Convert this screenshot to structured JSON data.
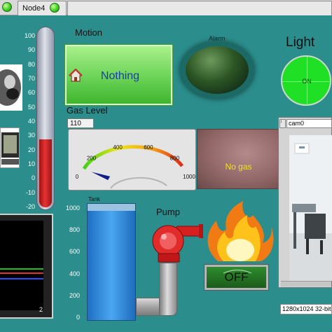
{
  "tabs": [
    {
      "label": "Node4"
    }
  ],
  "thermometer": {
    "ticks": [
      "100",
      "90",
      "80",
      "70",
      "60",
      "50",
      "40",
      "30",
      "20",
      "10",
      "0",
      "-10",
      "-20"
    ],
    "level": 0.38
  },
  "motion": {
    "label": "Motion",
    "button_label": "Nothing",
    "icon": "home-icon"
  },
  "alarm": {
    "label": "Alarm"
  },
  "light": {
    "label": "Light",
    "state_label": "ON"
  },
  "gas": {
    "label": "Gas Level",
    "value": "110",
    "ticks": [
      "0",
      "200",
      "400",
      "600",
      "800",
      "1000"
    ],
    "needle_value": 110,
    "status_text": "No gas"
  },
  "tank": {
    "label": "Tank",
    "ticks": [
      "1000",
      "800",
      "600",
      "400",
      "200",
      "0"
    ],
    "level": 0.94
  },
  "pump": {
    "label": "Pump",
    "button_label": "OFF"
  },
  "camera": {
    "name": "cam0",
    "status": "1280x1024 32-bit"
  },
  "graph": {
    "axis_label": "2"
  },
  "colors": {
    "background": "#2b8d8c",
    "led": "#3bd11f",
    "light_on": "#1fe024",
    "thermo_fill": "#d42222",
    "tank_fill": "#3a9be8"
  }
}
